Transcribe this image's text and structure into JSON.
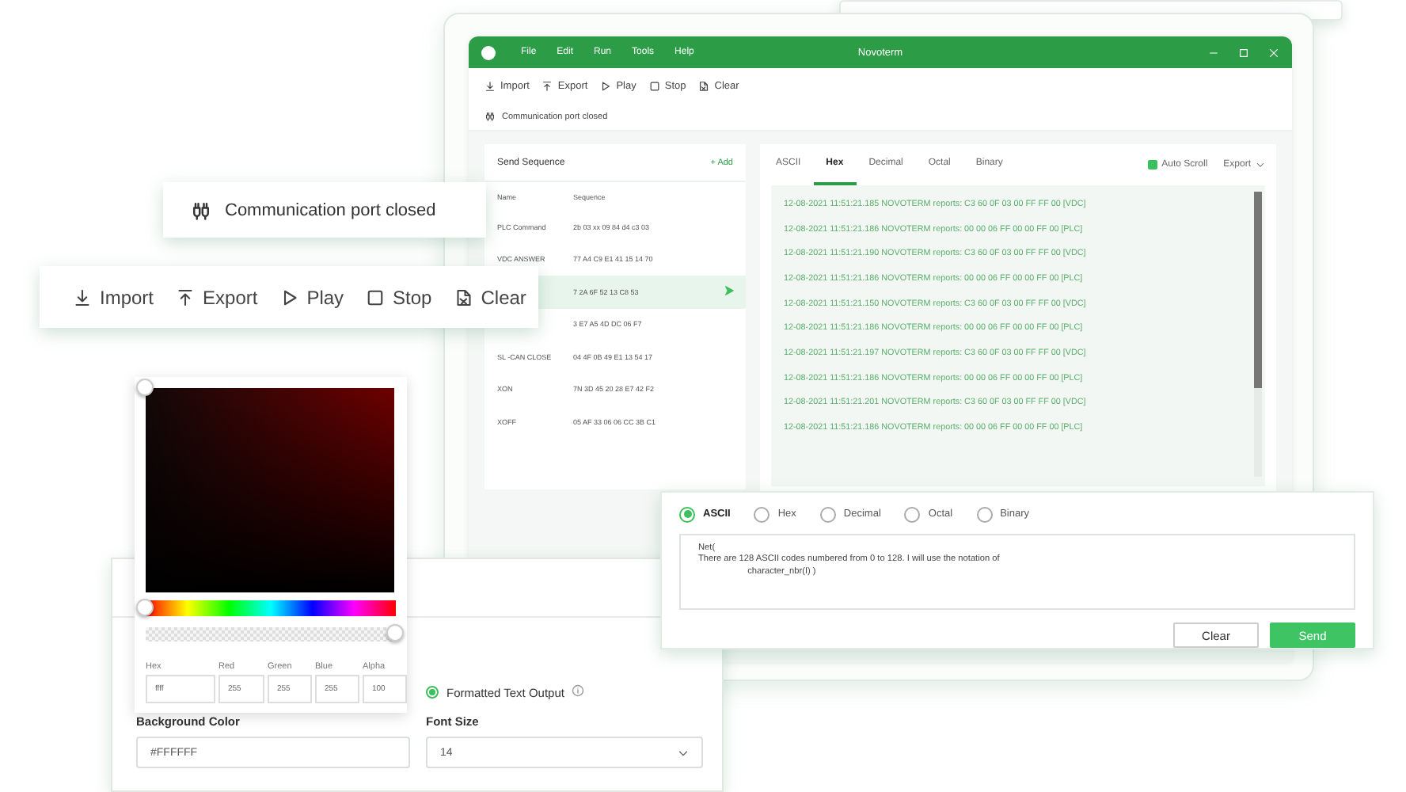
{
  "main_window": {
    "title": "Novoterm",
    "menu": [
      "File",
      "Edit",
      "Run",
      "Tools",
      "Help"
    ],
    "toolbar": [
      "Import",
      "Export",
      "Play",
      "Stop",
      "Clear"
    ],
    "status": "Communication port closed",
    "sequence_panel": {
      "title": "Send Sequence",
      "add": "+ Add",
      "columns": [
        "Name",
        "Sequence"
      ],
      "rows": [
        {
          "name": "PLC Command",
          "sequence": "2b 03 xx 09 84 d4 c3 03",
          "selected": false
        },
        {
          "name": "VDC ANSWER",
          "sequence": "77 A4 C9 E1 41 15 14 70",
          "selected": false
        },
        {
          "sequence": "7 2A 6F 52 13 C8 53",
          "selected": true
        },
        {
          "sequence": "3 E7 A5 4D DC 06 F7",
          "selected": false
        },
        {
          "name": "SL -CAN CLOSE",
          "sequence": "04 4F 0B 49 E1 13 54 17",
          "selected": false
        },
        {
          "name": "XON",
          "sequence": "7N 3D 45 20 28 E7 42 F2",
          "selected": false
        },
        {
          "name": "XOFF",
          "sequence": "05 AF 33 06 06 CC 3B C1",
          "selected": false
        }
      ]
    },
    "log_panel": {
      "tabs": [
        {
          "label": "ASCII",
          "selected": false
        },
        {
          "label": "Hex",
          "selected": true
        },
        {
          "label": "Decimal",
          "selected": false
        },
        {
          "label": "Octal",
          "selected": false
        },
        {
          "label": "Binary",
          "selected": false
        }
      ],
      "auto_scroll": {
        "label": "Auto Scroll",
        "checked": true
      },
      "export": "Export",
      "lines": [
        "12-08-2021 11:51:21.185 NOVOTERM reports: C3 60 0F 03 00 FF FF 00 [VDC]",
        "12-08-2021 11:51:21.186 NOVOTERM reports: 00 00 06 FF 00 00 FF 00 [PLC]",
        "12-08-2021 11:51:21.190 NOVOTERM reports: C3 60 0F 03 00 FF FF 00 [VDC]",
        "12-08-2021 11:51:21.186 NOVOTERM reports: 00 00 06 FF 00 00 FF 00 [PLC]",
        "12-08-2021 11:51:21.150 NOVOTERM reports: C3 60 0F 03 00 FF FF 00 [VDC]",
        "12-08-2021 11:51:21.186 NOVOTERM reports: 00 00 06 FF 00 00 FF 00 [PLC]",
        "12-08-2021 11:51:21.197 NOVOTERM reports: C3 60 0F 03 00 FF FF 00 [VDC]",
        "12-08-2021 11:51:21.186 NOVOTERM reports: 00 00 06 FF 00 00 FF 00 [PLC]",
        "12-08-2021 11:51:21.201 NOVOTERM reports: C3 60 0F 03 00 FF FF 00 [VDC]",
        "12-08-2021 11:51:21.186 NOVOTERM reports: 00 00 06 FF 00 00 FF 00 [PLC]"
      ]
    }
  },
  "status_popup": {
    "text": "Communication port closed"
  },
  "toolbar_popup": {
    "items": [
      "Import",
      "Export",
      "Play",
      "Stop",
      "Clear"
    ]
  },
  "color_picker": {
    "hue": {
      "level": 0
    },
    "alpha": {
      "level": 1
    },
    "fields": [
      {
        "label": "Hex",
        "value": "ffff"
      },
      {
        "label": "Red",
        "value": "255"
      },
      {
        "label": "Green",
        "value": "255"
      },
      {
        "label": "Blue",
        "value": "255"
      },
      {
        "label": "Alpha",
        "value": "100"
      }
    ]
  },
  "settings_panel": {
    "output": {
      "label": "Formatted Text Output",
      "selected": true
    },
    "background_color": {
      "label": "Background Color",
      "value": "#FFFFFF"
    },
    "font_size": {
      "label": "Font Size",
      "value": "14"
    }
  },
  "send_panel": {
    "formats": [
      {
        "label": "ASCII",
        "selected": true
      },
      {
        "label": "Hex",
        "selected": false
      },
      {
        "label": "Decimal",
        "selected": false
      },
      {
        "label": "Octal",
        "selected": false
      },
      {
        "label": "Binary",
        "selected": false
      }
    ],
    "message": "Net(\nThere are 128 ASCII codes numbered from 0 to 128. I will use the notation of\n                    character_nbr(I) )",
    "buttons": [
      {
        "label": "Clear",
        "kind": "secondary"
      },
      {
        "label": "Send",
        "kind": "primary"
      }
    ]
  }
}
